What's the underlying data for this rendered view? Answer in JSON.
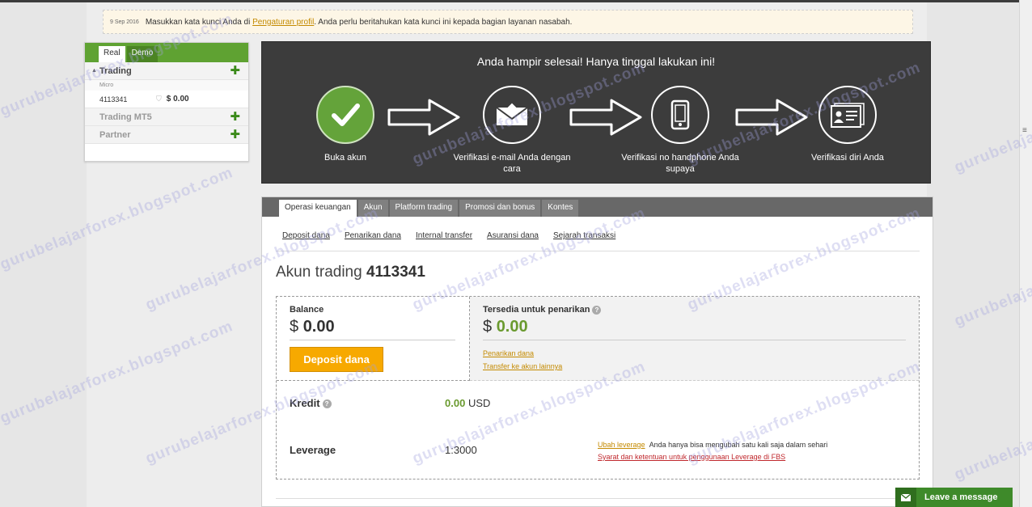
{
  "notice": {
    "date": "9 Sep 2016",
    "text_before": "Masukkan kata kunci Anda di ",
    "link": "Pengaturan profil",
    "text_after": ". Anda perlu beritahukan kata kunci ini kepada bagian layanan nasabah."
  },
  "account_panel": {
    "tabs": [
      "Real",
      "Demo"
    ],
    "trading_label": "Trading",
    "micro_label": "Micro",
    "account_number": "4113341",
    "account_balance": "$ 0.00",
    "mt5_label": "Trading MT5",
    "partner_label": "Partner"
  },
  "steps": {
    "title": "Anda hampir selesai! Hanya tinggal lakukan ini!",
    "items": [
      {
        "label": "Buka akun",
        "icon": "check-icon"
      },
      {
        "label": "Verifikasi e-mail Anda dengan cara",
        "icon": "envelope-icon"
      },
      {
        "label": "Verifikasi no handphone Anda supaya",
        "icon": "phone-icon"
      },
      {
        "label": "Verifikasi diri Anda",
        "icon": "id-card-icon"
      }
    ]
  },
  "tabs": [
    "Operasi keuangan",
    "Akun",
    "Platform trading",
    "Promosi dan bonus",
    "Kontes"
  ],
  "subnav": [
    "Deposit dana",
    "Penarikan dana",
    "Internal transfer",
    "Asuransi dana",
    "Sejarah transaksi"
  ],
  "account": {
    "title_prefix": "Akun trading",
    "number": "4113341",
    "balance_label": "Balance",
    "balance_currency": "$",
    "balance_value": "0.00",
    "deposit_button": "Deposit dana",
    "available_label": "Tersedia untuk penarikan",
    "available_currency": "$",
    "available_value": "0.00",
    "withdraw_link": "Penarikan dana",
    "transfer_link": "Transfer ke akun lainnya",
    "credit_label": "Kredit",
    "credit_value": "0.00",
    "credit_unit": "USD",
    "leverage_label": "Leverage",
    "leverage_value": "1:3000",
    "change_leverage_link": "Ubah leverage",
    "change_leverage_note": "Anda hanya bisa mengubah satu kali saja dalam sehari",
    "terms_link": "Syarat dan ketentuan untuk penggunaan Leverage di FBS"
  },
  "chat": {
    "label": "Leave a message"
  },
  "watermark": "gurubelajarforex.blogspot.com",
  "colors": {
    "brand_green": "#5fa232",
    "banner_dark": "#3c3c3c",
    "deposit_orange": "#f7a900",
    "value_green": "#6a9a2f",
    "link_orange": "#c48a00"
  }
}
